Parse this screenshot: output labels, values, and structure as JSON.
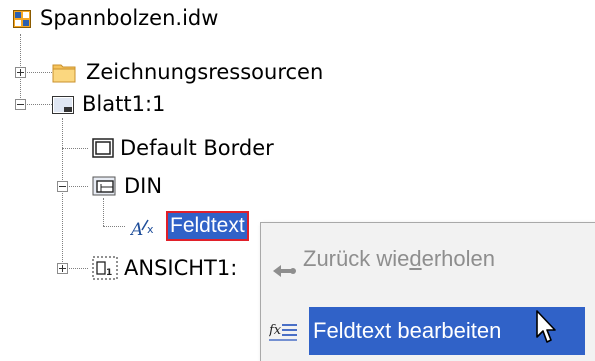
{
  "tree": {
    "root_label": "Spannbolzen.idw",
    "resources_label": "Zeichnungsressourcen",
    "sheet_label": "Blatt1:1",
    "border_label": "Default Border",
    "titleblock_label": "DIN",
    "fieldtext_label": "Feldtext",
    "view_label": "ANSICHT1:"
  },
  "context_menu": {
    "redo_before": "Zurück wie",
    "redo_accel": "d",
    "redo_after": "erholen",
    "edit_label": "Feldtext bearbeiten"
  },
  "colors": {
    "selection": "#3062c8",
    "selection_outline": "#e0202a",
    "menu_background": "#f2f2f2",
    "disabled_text": "#8e8e8e"
  },
  "icons": {
    "root": "drawing-file-icon",
    "resources": "folder-icon",
    "sheet": "sheet-icon",
    "border": "border-icon",
    "titleblock": "title-block-icon",
    "fieldtext": "field-text-icon",
    "view": "drawing-view-icon",
    "redo": "redo-arrow-icon",
    "edit": "edit-field-text-icon",
    "cursor": "mouse-cursor-icon"
  }
}
